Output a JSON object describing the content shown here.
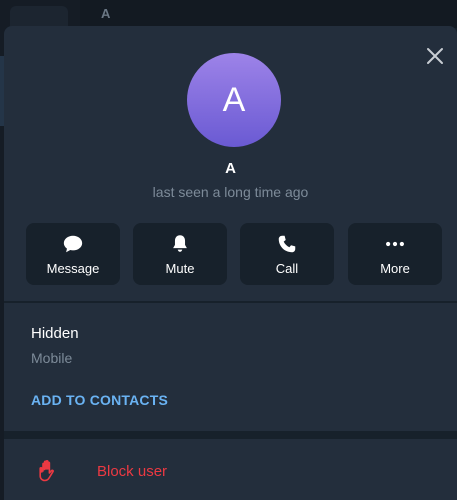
{
  "background": {
    "header_title": "A"
  },
  "profile": {
    "avatar_letter": "A",
    "name": "A",
    "status": "last seen a long time ago"
  },
  "actions": [
    {
      "label": "Message",
      "icon": "chat-bubble-icon"
    },
    {
      "label": "Mute",
      "icon": "bell-icon"
    },
    {
      "label": "Call",
      "icon": "phone-icon"
    },
    {
      "label": "More",
      "icon": "more-dots-icon"
    }
  ],
  "info": {
    "phone_value": "Hidden",
    "phone_label": "Mobile",
    "add_to_contacts": "ADD TO CONTACTS"
  },
  "block": {
    "label": "Block user",
    "icon": "hand-stop-icon"
  },
  "colors": {
    "accent": "#6ab3f3",
    "danger": "#ec3942",
    "avatar_top": "#9d83e8",
    "avatar_bottom": "#6a5ad3",
    "panel": "#232e3c",
    "surface": "#17212b"
  }
}
